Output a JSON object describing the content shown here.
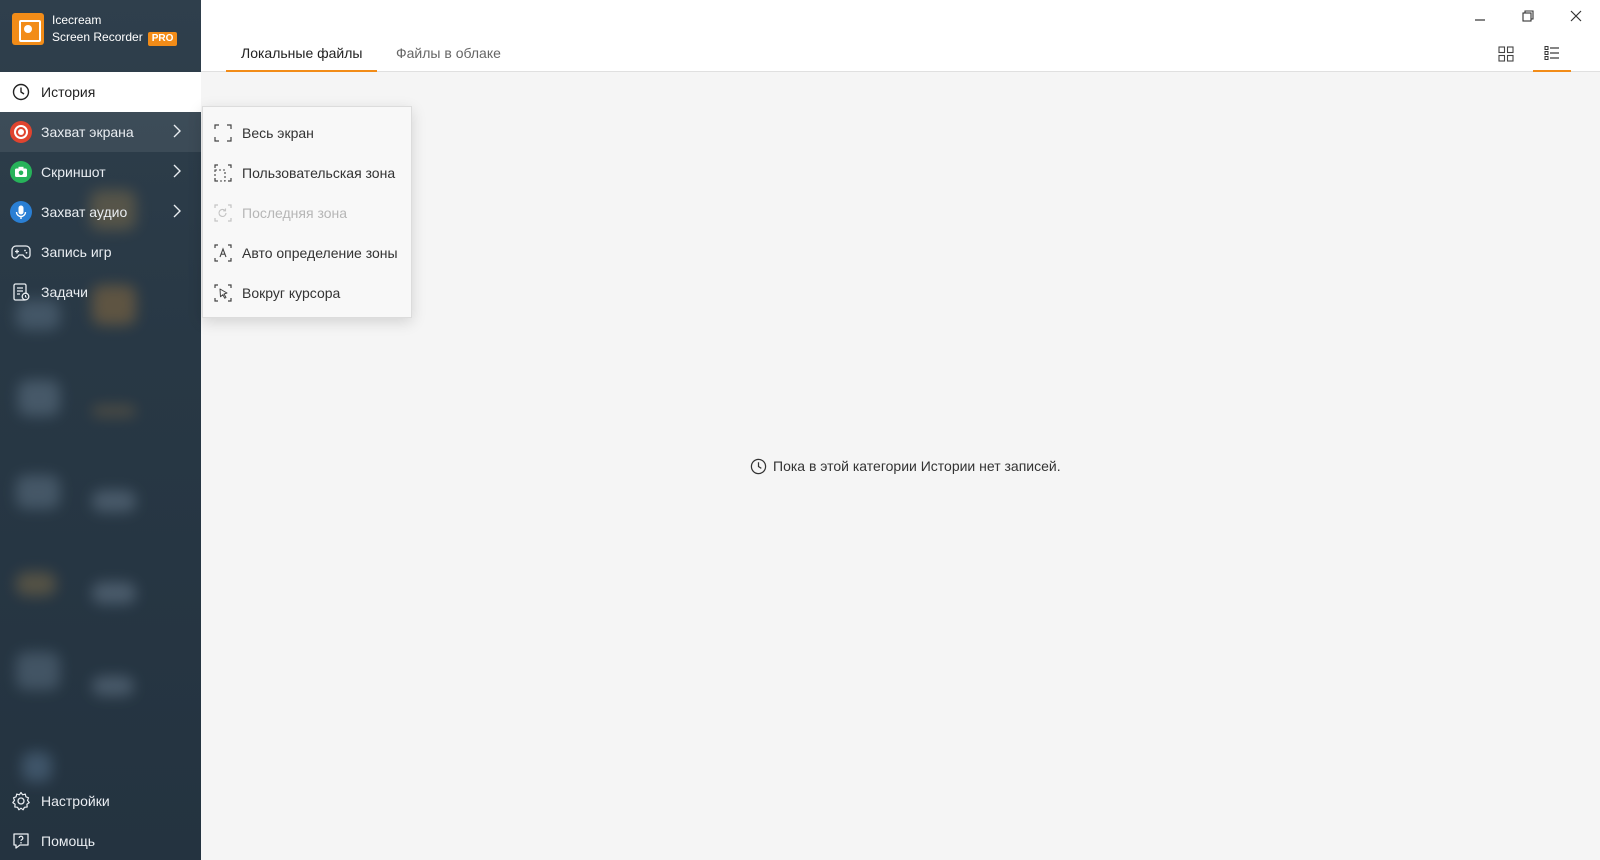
{
  "app": {
    "name_line1": "Icecream",
    "name_line2": "Screen Recorder",
    "badge": "PRO",
    "accent_color": "#f28c18"
  },
  "sidebar": {
    "items": [
      {
        "label": "История",
        "icon": "clock-icon",
        "active": true
      },
      {
        "label": "Захват экрана",
        "icon": "record-icon",
        "has_submenu": true,
        "icon_color": "#e0442f"
      },
      {
        "label": "Скриншот",
        "icon": "camera-icon",
        "has_submenu": true,
        "icon_color": "#27b35a"
      },
      {
        "label": "Захват аудио",
        "icon": "microphone-icon",
        "has_submenu": true,
        "icon_color": "#2a7fd4"
      },
      {
        "label": "Запись игр",
        "icon": "gamepad-icon"
      },
      {
        "label": "Задачи",
        "icon": "tasks-icon"
      }
    ],
    "bottom_items": [
      {
        "label": "Настройки",
        "icon": "gear-icon"
      },
      {
        "label": "Помощь",
        "icon": "help-icon"
      }
    ]
  },
  "tabs": [
    {
      "label": "Локальные файлы",
      "active": true
    },
    {
      "label": "Файлы в облаке",
      "active": false
    }
  ],
  "view_modes": [
    {
      "icon": "grid-view-icon",
      "active": false
    },
    {
      "icon": "list-view-icon",
      "active": true
    }
  ],
  "window_controls": [
    "minimize-icon",
    "restore-icon",
    "close-icon"
  ],
  "capture_menu": {
    "items": [
      {
        "label": "Весь экран",
        "icon": "fullscreen-icon",
        "enabled": true
      },
      {
        "label": "Пользовательская зона",
        "icon": "custom-area-icon",
        "enabled": true
      },
      {
        "label": "Последняя зона",
        "icon": "last-area-icon",
        "enabled": false
      },
      {
        "label": "Авто определение зоны",
        "icon": "auto-detect-icon",
        "enabled": true
      },
      {
        "label": "Вокруг курсора",
        "icon": "cursor-area-icon",
        "enabled": true
      }
    ]
  },
  "empty_state": {
    "message": "Пока в этой категории Истории нет записей.",
    "icon": "clock-icon"
  }
}
